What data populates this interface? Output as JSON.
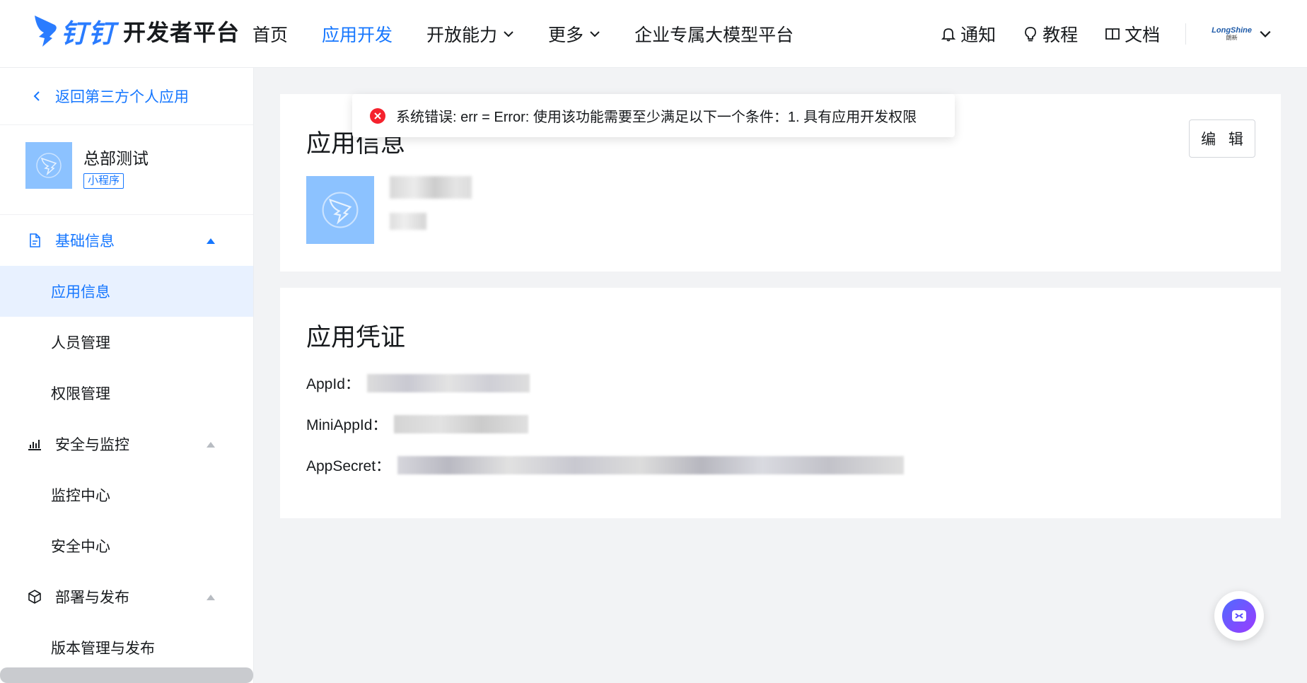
{
  "header": {
    "logo_brand": "钉钉",
    "logo_suffix": "开发者平台",
    "nav": [
      {
        "label": "首页"
      },
      {
        "label": "应用开发"
      },
      {
        "label": "开放能力"
      },
      {
        "label": "更多"
      },
      {
        "label": "企业专属大模型平台"
      }
    ],
    "active_nav": "应用开发",
    "tools": {
      "notify": "通知",
      "tutorial": "教程",
      "docs": "文档"
    },
    "org": {
      "logo_en": "LongShine",
      "logo_cn": "朗新"
    }
  },
  "sidebar": {
    "back_label": "返回第三方个人应用",
    "app": {
      "name": "总部测试",
      "tag": "小程序"
    },
    "groups": [
      {
        "label": "基础信息",
        "icon": "document-icon",
        "expanded": true,
        "items": [
          "应用信息",
          "人员管理",
          "权限管理"
        ]
      },
      {
        "label": "安全与监控",
        "icon": "bar-chart-icon",
        "expanded": true,
        "items": [
          "监控中心",
          "安全中心"
        ]
      },
      {
        "label": "部署与发布",
        "icon": "cube-icon",
        "expanded": true,
        "items": [
          "版本管理与发布"
        ]
      }
    ],
    "selected_item": "应用信息"
  },
  "main": {
    "info_card": {
      "title": "应用信息",
      "edit_label": "编 辑"
    },
    "cred_card": {
      "title": "应用凭证",
      "fields": [
        {
          "label": "AppId："
        },
        {
          "label": "MiniAppId："
        },
        {
          "label": "AppSecret："
        }
      ]
    }
  },
  "toast": {
    "type": "error",
    "message": "系统错误: err = Error: 使用该功能需要至少满足以下一个条件：1. 具有应用开发权限"
  },
  "colors": {
    "primary": "#1677ff",
    "error": "#f5222d",
    "background": "#f2f3f5",
    "selected_bg": "#e8f1ff"
  }
}
